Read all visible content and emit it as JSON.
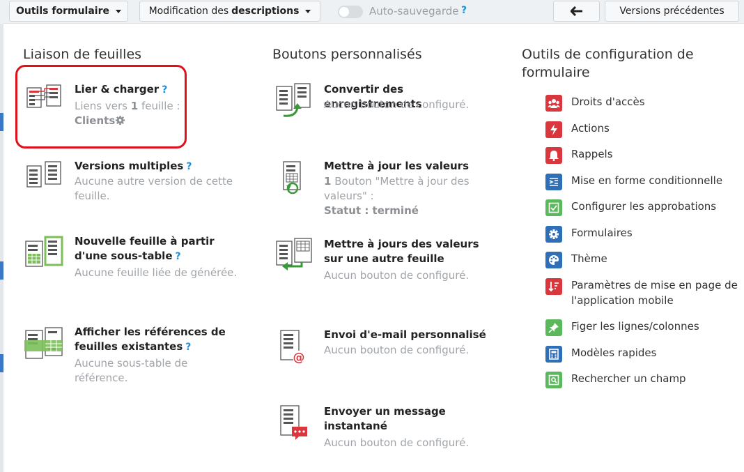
{
  "toolbar": {
    "form_tools": "Outils formulaire",
    "mode_prefix": "Modification des",
    "mode_bold": "descriptions",
    "autosave": "Auto-sauvegarde",
    "help": "?",
    "back_icon": "arrow-left-icon",
    "previous_versions": "Versions précédentes"
  },
  "columns": {
    "linking": {
      "title": "Liaison de feuilles",
      "items": [
        {
          "title": "Lier & charger",
          "help": "?",
          "desc_prefix": "Liens vers",
          "desc_count": "1",
          "desc_suffix": "feuille :",
          "link": "Clients",
          "icon": "link-load-icon"
        },
        {
          "title": "Versions multiples",
          "help": "?",
          "desc": "Aucune autre version de cette feuille.",
          "icon": "multiple-versions-icon"
        },
        {
          "title": "Nouvelle feuille à partir d'une sous-table",
          "help": "?",
          "desc": "Aucune feuille liée de générée.",
          "icon": "new-sheet-subtable-icon"
        },
        {
          "title": "Afficher les références de feuilles existantes",
          "help": "?",
          "desc": "Aucune sous-table de référence.",
          "icon": "sheet-references-icon"
        }
      ]
    },
    "buttons": {
      "title": "Boutons personnalisés",
      "items": [
        {
          "title": "Convertir des enregistrements",
          "desc": "Aucun bouton de configuré.",
          "icon": "convert-records-icon"
        },
        {
          "title": "Mettre à jour les valeurs",
          "desc_count": "1",
          "desc_text": "Bouton \"Mettre à jour des valeurs\" :",
          "status": "Statut : terminé",
          "icon": "update-values-icon"
        },
        {
          "title": "Mettre à jours des valeurs sur une autre feuille",
          "desc": "Aucun bouton de configuré.",
          "icon": "update-other-sheet-icon"
        },
        {
          "title": "Envoi d'e-mail personnalisé",
          "desc": "Aucun bouton de configuré.",
          "icon": "email-icon"
        },
        {
          "title": "Envoyer un message instantané",
          "desc": "Aucun bouton de configuré.",
          "icon": "instant-message-icon"
        }
      ]
    },
    "config": {
      "title": "Outils de configuration de formulaire",
      "items": [
        {
          "label": "Droits d'accès",
          "color": "#d9363e",
          "icon": "users-icon"
        },
        {
          "label": "Actions",
          "color": "#d9363e",
          "icon": "lightning-icon"
        },
        {
          "label": "Rappels",
          "color": "#d9363e",
          "icon": "bell-icon"
        },
        {
          "label": "Mise en forme conditionnelle",
          "color": "#2f6fb8",
          "icon": "conditional-format-icon"
        },
        {
          "label": "Configurer les approbations",
          "color": "#5cb85c",
          "icon": "checkbox-icon"
        },
        {
          "label": "Formulaires",
          "color": "#2f6fb8",
          "icon": "gear-icon"
        },
        {
          "label": "Thème",
          "color": "#2f6fb8",
          "icon": "palette-icon"
        },
        {
          "label": "Paramètres de mise en page de l'application mobile",
          "color": "#d9363e",
          "icon": "sort-icon"
        },
        {
          "label": "Figer les lignes/colonnes",
          "color": "#5cb85c",
          "icon": "pin-icon"
        },
        {
          "label": "Modèles rapides",
          "color": "#2f6fb8",
          "icon": "calculator-icon"
        },
        {
          "label": "Rechercher un champ",
          "color": "#5cb85c",
          "icon": "search-icon"
        }
      ]
    }
  }
}
